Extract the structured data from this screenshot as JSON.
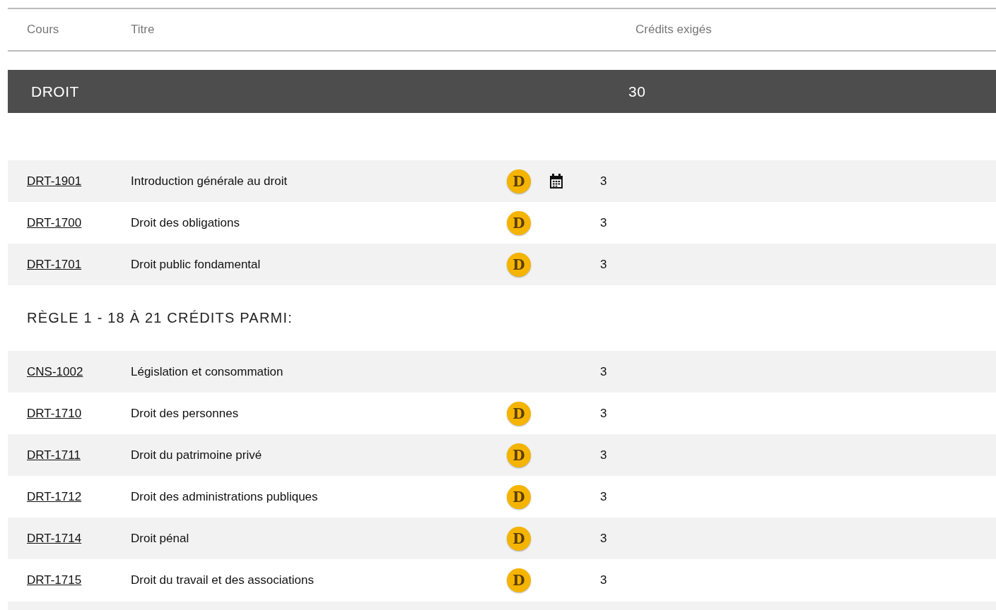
{
  "table": {
    "columns": [
      "Cours",
      "Titre",
      "Crédits exigés"
    ],
    "group": {
      "name": "DROIT",
      "credits": "30"
    },
    "sections": [
      {
        "rows": [
          {
            "code": "DRT-1901",
            "title": "Introduction générale au droit",
            "badge": "D",
            "calendar": true,
            "credits": "3"
          },
          {
            "code": "DRT-1700",
            "title": "Droit des obligations",
            "badge": "D",
            "calendar": false,
            "credits": "3"
          },
          {
            "code": "DRT-1701",
            "title": "Droit public fondamental",
            "badge": "D",
            "calendar": false,
            "credits": "3"
          }
        ]
      },
      {
        "heading": "RÈGLE 1 - 18 À 21 CRÉDITS PARMI:",
        "rows": [
          {
            "code": "CNS-1002",
            "title": "Législation et consommation",
            "calendar": false,
            "credits": "3"
          },
          {
            "code": "DRT-1710",
            "title": "Droit des personnes",
            "badge": "D",
            "calendar": false,
            "credits": "3"
          },
          {
            "code": "DRT-1711",
            "title": "Droit du patrimoine privé",
            "badge": "D",
            "calendar": false,
            "credits": "3"
          },
          {
            "code": "DRT-1712",
            "title": "Droit des administrations publiques",
            "badge": "D",
            "calendar": false,
            "credits": "3"
          },
          {
            "code": "DRT-1714",
            "title": "Droit pénal",
            "badge": "D",
            "calendar": false,
            "credits": "3"
          },
          {
            "code": "DRT-1715",
            "title": "Droit du travail et des associations",
            "badge": "D",
            "calendar": false,
            "credits": "3"
          }
        ]
      }
    ]
  }
}
